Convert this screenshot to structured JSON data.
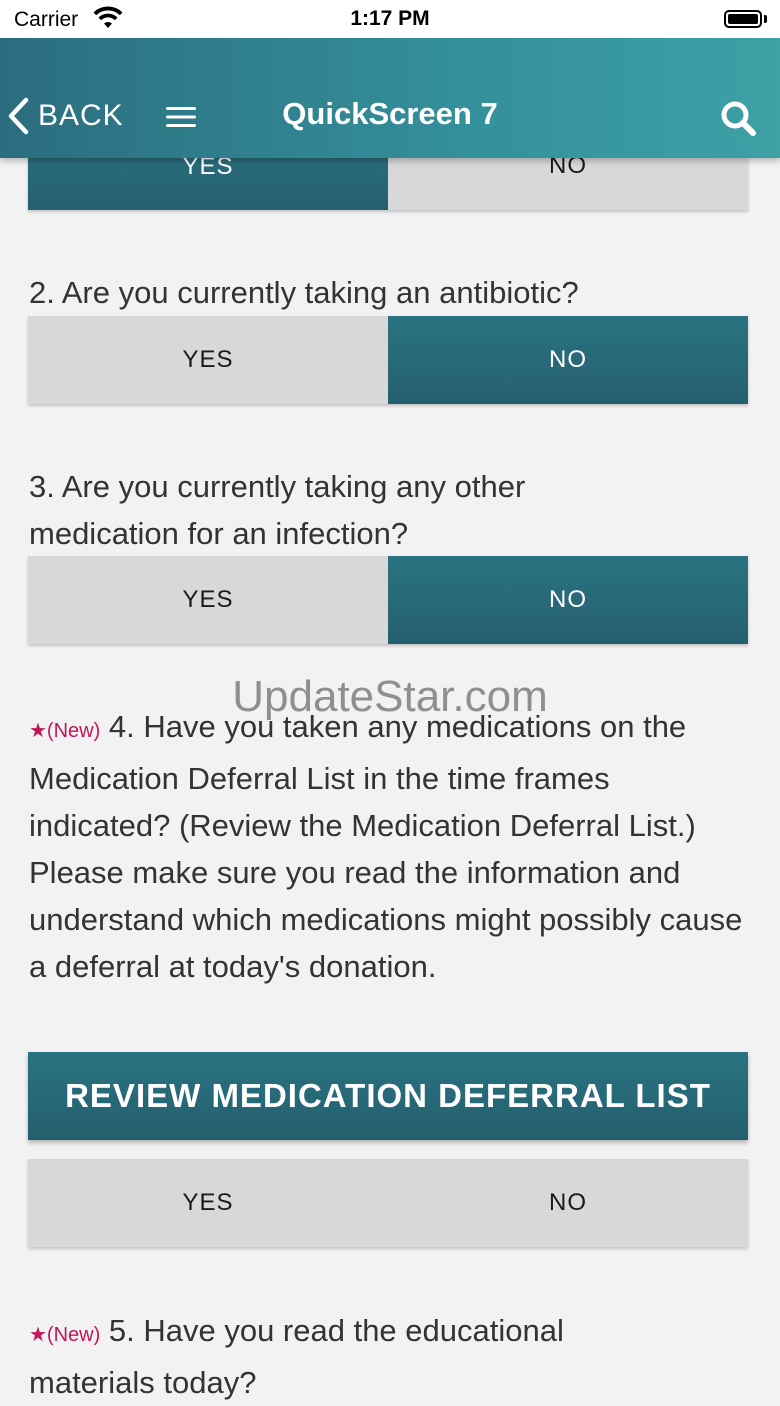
{
  "status_bar": {
    "carrier": "Carrier",
    "time": "1:17 PM"
  },
  "nav": {
    "back_label": "BACK",
    "title": "QuickScreen 7"
  },
  "questions": [
    {
      "id": 1,
      "yes_label": "YES",
      "no_label": "NO",
      "selected": "yes"
    },
    {
      "id": 2,
      "text": "2. Are you currently taking an antibiotic?",
      "yes_label": "YES",
      "no_label": "NO",
      "selected": "no"
    },
    {
      "id": 3,
      "text": "3. Are you currently taking any other medication for an infection?",
      "yes_label": "YES",
      "no_label": "NO",
      "selected": "no"
    },
    {
      "id": 4,
      "new_marker": "★(New)",
      "text": " 4. Have you taken any medications on the Medication Deferral List in the time frames indicated? (Review the Medication Deferral List.)",
      "subtext": "Please make sure you read the information and understand which medications might possibly cause a deferral at today's donation.",
      "button_label": "REVIEW MEDICATION DEFERRAL LIST",
      "yes_label": "YES",
      "no_label": "NO",
      "selected": "none"
    },
    {
      "id": 5,
      "new_marker": "★(New)",
      "text": " 5. Have you read the educational materials today?"
    }
  ],
  "watermark": "UpdateStar.com",
  "colors": {
    "accent": "#26606f",
    "nav_gradient_start": "#2b6d7f",
    "nav_gradient_end": "#3da1a6",
    "unselected": "#d8d8d8",
    "new_marker": "#c2185b"
  }
}
